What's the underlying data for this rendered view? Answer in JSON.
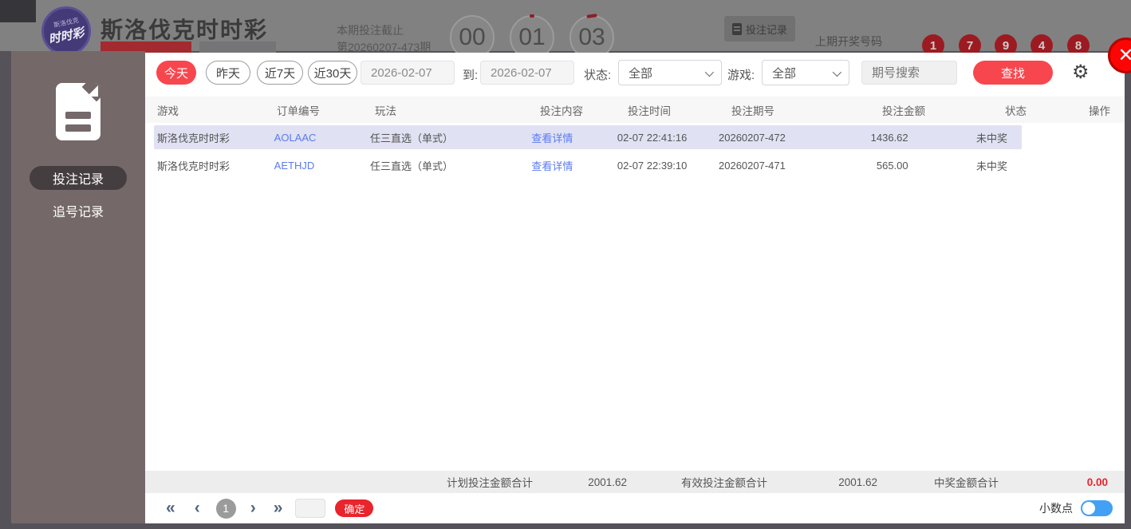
{
  "page": {
    "title": "斯洛伐克时时彩",
    "deadline_label": "本期投注截止",
    "deadline_period": "第20260207-473期",
    "countdown": [
      "00",
      "01",
      "03"
    ],
    "record_button": "投注记录",
    "last_draw_label": "上期开奖号码",
    "last_draw_numbers": [
      "1",
      "7",
      "9",
      "4",
      "8"
    ]
  },
  "sidebar": {
    "items": [
      {
        "label": "投注记录",
        "active": true
      },
      {
        "label": "追号记录",
        "active": false
      }
    ]
  },
  "filters": {
    "quick": [
      "今天",
      "昨天",
      "近7天",
      "近30天"
    ],
    "active_quick": "今天",
    "date_from": "2026-02-07",
    "to_label": "到:",
    "date_to": "2026-02-07",
    "status_label": "状态:",
    "status_value": "全部",
    "game_label": "游戏:",
    "game_value": "全部",
    "search_placeholder": "期号搜索",
    "search_button": "查找"
  },
  "table": {
    "columns": [
      "游戏",
      "订单编号",
      "玩法",
      "投注内容",
      "投注时间",
      "投注期号",
      "投注金额",
      "状态",
      "操作"
    ],
    "rows": [
      {
        "game": "斯洛伐克时时彩",
        "order": "AOLAAC",
        "play": "任三直选（单式）",
        "content": "查看详情",
        "time": "02-07 22:41:16",
        "period": "20260207-472",
        "amount": "1436.62",
        "status": "未中奖",
        "highlighted": true
      },
      {
        "game": "斯洛伐克时时彩",
        "order": "AETHJD",
        "play": "任三直选（单式）",
        "content": "查看详情",
        "time": "02-07 22:39:10",
        "period": "20260207-471",
        "amount": "565.00",
        "status": "未中奖",
        "highlighted": false
      }
    ]
  },
  "summary": {
    "planned_label": "计划投注金额合计",
    "planned_value": "2001.62",
    "valid_label": "有效投注金额合计",
    "valid_value": "2001.62",
    "win_label": "中奖金额合计",
    "win_value": "0.00"
  },
  "pagination": {
    "current_page": "1",
    "confirm_button": "确定",
    "decimal_label": "小数点",
    "decimal_on": true
  },
  "colors": {
    "accent_red": "#f8464e",
    "deep_red": "#e8242c",
    "link_blue": "#5b7bf0",
    "row_highlight": "#e0e1f2",
    "sidebar": "#756868",
    "toggle_blue": "#42a0f5",
    "close_red": "#fb0505"
  }
}
